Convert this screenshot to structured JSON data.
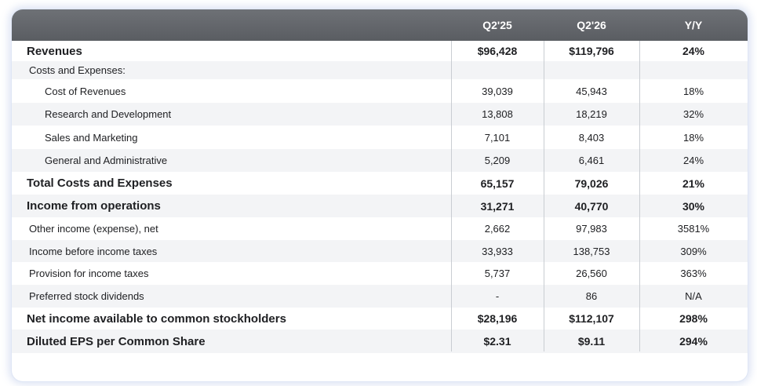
{
  "header": {
    "col1": "Q2'25",
    "col2": "Q2'26",
    "col3": "Y/Y"
  },
  "rows": [
    {
      "label": "Revenues",
      "q225": "$96,428",
      "q226": "$119,796",
      "yy": "24%"
    },
    {
      "label": "Costs and Expenses:",
      "q225": "",
      "q226": "",
      "yy": ""
    },
    {
      "label": "Cost of Revenues",
      "q225": "39,039",
      "q226": "45,943",
      "yy": "18%"
    },
    {
      "label": "Research and Development",
      "q225": "13,808",
      "q226": "18,219",
      "yy": "32%"
    },
    {
      "label": "Sales and Marketing",
      "q225": "7,101",
      "q226": "8,403",
      "yy": "18%"
    },
    {
      "label": "General and Administrative",
      "q225": "5,209",
      "q226": "6,461",
      "yy": "24%"
    },
    {
      "label": "Total Costs and Expenses",
      "q225": "65,157",
      "q226": "79,026",
      "yy": "21%"
    },
    {
      "label": "Income from operations",
      "q225": "31,271",
      "q226": "40,770",
      "yy": "30%"
    },
    {
      "label": "Other income (expense), net",
      "q225": "2,662",
      "q226": "97,983",
      "yy": "3581%"
    },
    {
      "label": "Income before income taxes",
      "q225": "33,933",
      "q226": "138,753",
      "yy": "309%"
    },
    {
      "label": "Provision for income taxes",
      "q225": "5,737",
      "q226": "26,560",
      "yy": "363%"
    },
    {
      "label": "Preferred stock dividends",
      "q225": "-",
      "q226": "86",
      "yy": "N/A"
    },
    {
      "label": "Net income available to common stockholders",
      "q225": "$28,196",
      "q226": "$112,107",
      "yy": "298%"
    },
    {
      "label": "Diluted EPS per Common Share",
      "q225": "$2.31",
      "q226": "$9.11",
      "yy": "294%"
    }
  ]
}
